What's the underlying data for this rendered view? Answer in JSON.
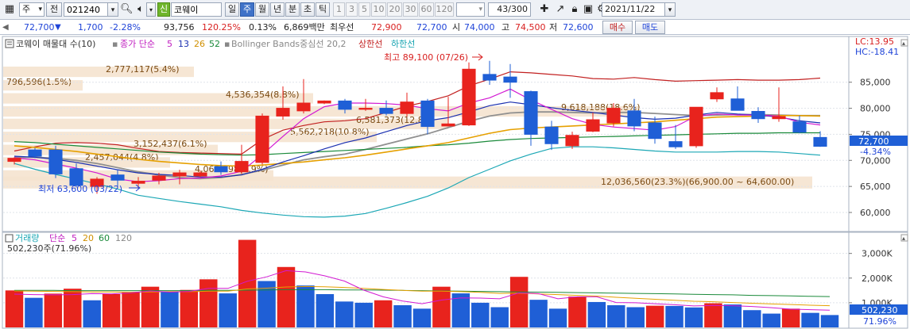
{
  "toolbar": {
    "grid_icon": "grid-icon",
    "period_select": "주",
    "period_select_chevron": "▾",
    "prev_label": "전",
    "code": "021240",
    "code_chevron": "▾",
    "search_icon": "search-icon",
    "sound_icon": "speaker-icon",
    "sound_chevron": "▾",
    "new_badge": "신",
    "stock_name": "코웨이",
    "periods": [
      {
        "label": "일",
        "active": false
      },
      {
        "label": "주",
        "active": true
      },
      {
        "label": "월",
        "active": false
      },
      {
        "label": "년",
        "active": false
      },
      {
        "label": "분",
        "active": false
      },
      {
        "label": "초",
        "active": false
      },
      {
        "label": "틱",
        "active": false
      }
    ],
    "intervals": [
      "1",
      "3",
      "5",
      "10",
      "20",
      "30",
      "60",
      "120"
    ],
    "interval_dropdown_chevron": "▾",
    "count": "43/300",
    "tool_icons": [
      "crosshair-icon",
      "trend-tool-icon",
      "lock-icon",
      "save-icon",
      "settings-icon"
    ],
    "date": "2021/11/22",
    "date_chevron": "▾"
  },
  "quote": {
    "scroll_left": "◀",
    "price": "72,700",
    "change_arrow": "▼",
    "change": "1,700",
    "change_pct": "-2.28%",
    "volume": "93,756",
    "volume_ratio": "120.25%",
    "turnover_ratio": "0.13%",
    "amount": "6,869백만",
    "best_label": "최우선",
    "best_ask": "72,900",
    "best_bid": "72,700",
    "open_label": "시",
    "open": "74,000",
    "high_label": "고",
    "high": "74,500",
    "low_label": "저",
    "low": "72,600",
    "buy_button": "매수",
    "sell_button": "매도"
  },
  "price_panel": {
    "legend_title": "코웨이 매물대 수(10)",
    "legend_ma_label": "종가 단순",
    "legend_ma_periods": [
      "5",
      "13",
      "26",
      "52"
    ],
    "legend_bb": "Bollinger Bands중심선 20,2",
    "legend_upper": "상한선",
    "legend_lower": "하한선",
    "lc_label": "LC:13.95",
    "hc_label": "HC:-18.41",
    "current_price_label": "72,700",
    "current_change_label": "-4.34%",
    "max_label": "최고 89,100 (07/26)",
    "min_label": "최저 63,600 (03/22)",
    "volume_profile_labels": [
      "2,777,117(5.4%)",
      "796,596(1.5%)",
      "4,536,354(8.8%)",
      "9,618,188(18.6%)",
      "6,581,373(12.8%)",
      "5,562,218(10.8%)",
      "3,152,437(6.1%)",
      "2,457,044(4.8%)",
      "4,063,998(7.9%)",
      "12,036,560(23.3%)(66,900.00 ~ 64,600.00)"
    ]
  },
  "volume_panel": {
    "legend_title": "거래량",
    "legend_ma_label": "단순",
    "legend_ma_periods": [
      "5",
      "20",
      "60",
      "120"
    ],
    "current_volume": "502,230주(71.96%)",
    "current_volume_label": "502,230",
    "current_volume_pct": "71.96%"
  },
  "colors": {
    "up": "#e8231d",
    "down": "#1f5fd6",
    "ma5": "#d219d2",
    "ma13": "#1a2fb0",
    "ma26": "#e6a000",
    "ma52": "#1a8a3a",
    "bb_mid": "#909090",
    "bb_upper": "#c22020",
    "bb_lower": "#1ba7b5",
    "volume_profile": "#f5e3cf"
  },
  "chart_data": {
    "type": "candlestick",
    "price_axis": {
      "ticks": [
        "85,000",
        "80,000",
        "75,000",
        "70,000",
        "65,000",
        "60,000"
      ],
      "ylim": [
        56500,
        91500
      ]
    },
    "volume_axis": {
      "ticks": [
        "3,000K",
        "2,000K",
        "1,000K"
      ],
      "ylim": [
        0,
        3600
      ]
    },
    "ohlc": [
      [
        69800,
        70600,
        69200,
        70400
      ],
      [
        72000,
        72400,
        70400,
        70800
      ],
      [
        72000,
        72800,
        66600,
        67400
      ],
      [
        68400,
        69400,
        64800,
        65200
      ],
      [
        65000,
        66800,
        63600,
        66400
      ],
      [
        67200,
        68200,
        64800,
        66200
      ],
      [
        65600,
        66800,
        64600,
        66000
      ],
      [
        66200,
        67600,
        65400,
        67000
      ],
      [
        67000,
        68200,
        65400,
        67600
      ],
      [
        67000,
        68000,
        66800,
        67600
      ],
      [
        68800,
        69800,
        67200,
        67800
      ],
      [
        67800,
        73000,
        67400,
        69800
      ],
      [
        69600,
        79000,
        69200,
        78500
      ],
      [
        78500,
        84200,
        77800,
        80000
      ],
      [
        79500,
        85600,
        79000,
        81000
      ],
      [
        81000,
        81500,
        80800,
        81400
      ],
      [
        81400,
        81800,
        79000,
        79800
      ],
      [
        79800,
        81800,
        79500,
        80000
      ],
      [
        80000,
        81500,
        78600,
        79000
      ],
      [
        79000,
        83000,
        78400,
        81200
      ],
      [
        81400,
        81800,
        75000,
        76500
      ],
      [
        76600,
        82200,
        76500,
        77000
      ],
      [
        76800,
        88800,
        76600,
        87500
      ],
      [
        86500,
        89100,
        84500,
        85400
      ],
      [
        86000,
        88500,
        82000,
        85000
      ],
      [
        83200,
        83400,
        72800,
        75000
      ],
      [
        76400,
        77600,
        72000,
        73200
      ],
      [
        72800,
        75500,
        72200,
        74800
      ],
      [
        75600,
        79200,
        75400,
        77800
      ],
      [
        77200,
        81000,
        76500,
        80000
      ],
      [
        79500,
        81800,
        75600,
        76600
      ],
      [
        77200,
        78400,
        73200,
        74200
      ],
      [
        73600,
        76800,
        72200,
        72600
      ],
      [
        72800,
        80000,
        72400,
        80200
      ],
      [
        81800,
        84000,
        81200,
        83000
      ],
      [
        81800,
        84200,
        79600,
        79600
      ],
      [
        79400,
        80200,
        77200,
        78000
      ],
      [
        78000,
        84000,
        77400,
        78400
      ],
      [
        77400,
        78600,
        75200,
        75400
      ],
      [
        74400,
        75600,
        72600,
        72700
      ]
    ],
    "volume_k": [
      1500,
      1200,
      1370,
      1570,
      1100,
      1350,
      1420,
      1650,
      1450,
      1520,
      1950,
      1380,
      3550,
      1880,
      2450,
      1700,
      1350,
      1050,
      1000,
      1100,
      900,
      760,
      1650,
      1380,
      1000,
      820,
      2050,
      1120,
      760,
      1250,
      1030,
      900,
      820,
      880,
      870,
      810,
      980,
      930,
      700,
      560,
      760,
      590,
      502
    ],
    "bb_upper": [
      71800,
      72600,
      73300,
      73400,
      73300,
      73000,
      72300,
      71700,
      71500,
      71400,
      71300,
      71200,
      74000,
      75800,
      76700,
      77400,
      77600,
      78000,
      79200,
      80400,
      81300,
      82400,
      84300,
      85600,
      87000,
      86800,
      86500,
      86200,
      85700,
      85600,
      85900,
      85500,
      85200,
      85300,
      85400,
      85500,
      85400,
      85400,
      85500,
      85800
    ],
    "bb_mid": [
      70600,
      70600,
      70400,
      70000,
      69400,
      68600,
      67800,
      67200,
      66700,
      66500,
      66700,
      67300,
      68100,
      69100,
      70100,
      70700,
      71200,
      72100,
      73100,
      74100,
      75100,
      76300,
      77500,
      78500,
      79100,
      79300,
      79300,
      79200,
      79100,
      79200,
      79200,
      79000,
      78800,
      78600,
      78700,
      78800,
      78800,
      78700,
      78600,
      78600
    ],
    "bb_lower": [
      69400,
      68300,
      67300,
      66400,
      65500,
      64500,
      63300,
      62700,
      62100,
      61600,
      61100,
      60400,
      59900,
      59500,
      59200,
      59100,
      59300,
      59800,
      60800,
      61900,
      63100,
      64700,
      66700,
      68300,
      69900,
      71200,
      72300,
      72600,
      72600,
      72400,
      72100,
      71800,
      71600,
      71600,
      71600,
      71700,
      71700,
      71600,
      71300,
      71000
    ],
    "ma5": [
      70500,
      70100,
      69300,
      68500,
      67600,
      66400,
      65900,
      66100,
      66500,
      66600,
      67000,
      67900,
      71100,
      74600,
      78000,
      80300,
      81000,
      81000,
      80900,
      80600,
      79900,
      79500,
      81000,
      82000,
      83700,
      81600,
      79800,
      78000,
      76900,
      76400,
      76100,
      75800,
      76500,
      78500,
      78900,
      78700,
      78700,
      78500,
      77300,
      76800
    ],
    "ma13": [
      70800,
      70600,
      70200,
      69600,
      68900,
      68200,
      67600,
      67300,
      67100,
      66800,
      66800,
      67200,
      68300,
      69700,
      70900,
      72200,
      73400,
      74300,
      75500,
      76700,
      77600,
      78200,
      79300,
      80500,
      81200,
      80700,
      80100,
      79600,
      79200,
      78700,
      78200,
      77900,
      78100,
      78700,
      79200,
      78900,
      78700,
      78300,
      77600,
      77200
    ],
    "ma26": [
      72800,
      72500,
      72100,
      71700,
      71200,
      70700,
      70200,
      69800,
      69500,
      69200,
      69000,
      68900,
      69100,
      69400,
      69700,
      70100,
      70500,
      71000,
      71600,
      72200,
      72800,
      73400,
      74300,
      75200,
      75900,
      76200,
      76400,
      76600,
      76800,
      77000,
      77200,
      77400,
      77700,
      78000,
      78300,
      78400,
      78500,
      78600,
      78600,
      78500
    ],
    "ma52": [
      73600,
      73400,
      73100,
      72800,
      72500,
      72200,
      71900,
      71600,
      71400,
      71200,
      71100,
      71000,
      71100,
      71300,
      71500,
      71700,
      71900,
      72100,
      72300,
      72500,
      72800,
      73000,
      73300,
      73700,
      74000,
      74200,
      74300,
      74400,
      74500,
      74600,
      74700,
      74800,
      74900,
      75000,
      75100,
      75200,
      75200,
      75300,
      75300,
      75300
    ],
    "vol_ma5": [
      1350,
      1330,
      1320,
      1330,
      1370,
      1360,
      1400,
      1480,
      1430,
      1460,
      1580,
      1580,
      1870,
      2050,
      2300,
      2250,
      2090,
      1880,
      1510,
      1240,
      1070,
      960,
      1110,
      1200,
      1190,
      1160,
      1400,
      1370,
      1160,
      1240,
      1240,
      1010,
      1000,
      960,
      920,
      870,
      890,
      880,
      850,
      800,
      740,
      720,
      700
    ],
    "vol_ma20": [
      1480,
      1470,
      1460,
      1450,
      1440,
      1440,
      1430,
      1440,
      1450,
      1450,
      1470,
      1470,
      1560,
      1590,
      1640,
      1660,
      1650,
      1620,
      1580,
      1540,
      1500,
      1470,
      1470,
      1450,
      1420,
      1380,
      1390,
      1360,
      1330,
      1300,
      1270,
      1220,
      1180,
      1140,
      1100,
      1060,
      1040,
      1010,
      980,
      950,
      930,
      900,
      880
    ],
    "vol_ma60": [
      1500,
      1500,
      1500,
      1490,
      1490,
      1490,
      1490,
      1490,
      1490,
      1490,
      1500,
      1500,
      1510,
      1520,
      1530,
      1530,
      1530,
      1520,
      1520,
      1510,
      1500,
      1490,
      1480,
      1470,
      1460,
      1450,
      1440,
      1430,
      1420,
      1410,
      1400,
      1390,
      1380,
      1370,
      1360,
      1340,
      1330,
      1320,
      1300,
      1290,
      1280,
      1260,
      1250
    ]
  }
}
